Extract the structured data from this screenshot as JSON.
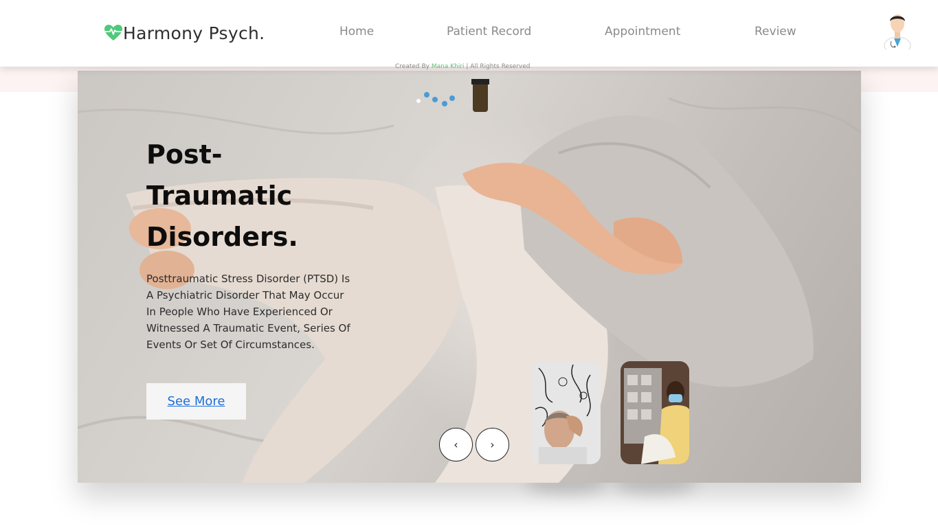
{
  "brand": {
    "name": "Harmony Psych.",
    "icon": "heart-pulse-icon",
    "accent_color": "#4fc97a"
  },
  "nav": {
    "items": [
      {
        "label": "Home"
      },
      {
        "label": "Patient Record"
      },
      {
        "label": "Appointment"
      },
      {
        "label": "Review"
      }
    ],
    "avatar": "doctor-avatar-icon"
  },
  "credit": {
    "prefix": "Created By",
    "author": "Mana Khiri",
    "suffix": "| All Rights Reserved"
  },
  "hero": {
    "title": "Post-Traumatic Disorders.",
    "description": "Posttraumatic Stress Disorder (PTSD) Is A Psychiatric Disorder That May Occur In People Who Have Experienced Or Witnessed A Traumatic Event, Series Of Events Or Set Of Circumstances.",
    "cta_label": "See More",
    "prev_label": "‹",
    "next_label": "›",
    "thumbnails": [
      {
        "name": "stressed-man-thumbnail"
      },
      {
        "name": "masked-woman-thumbnail"
      }
    ]
  },
  "colors": {
    "link": "#1e6fd9",
    "nav_text": "#8a8a8a",
    "strip": "#fdf3f2"
  }
}
